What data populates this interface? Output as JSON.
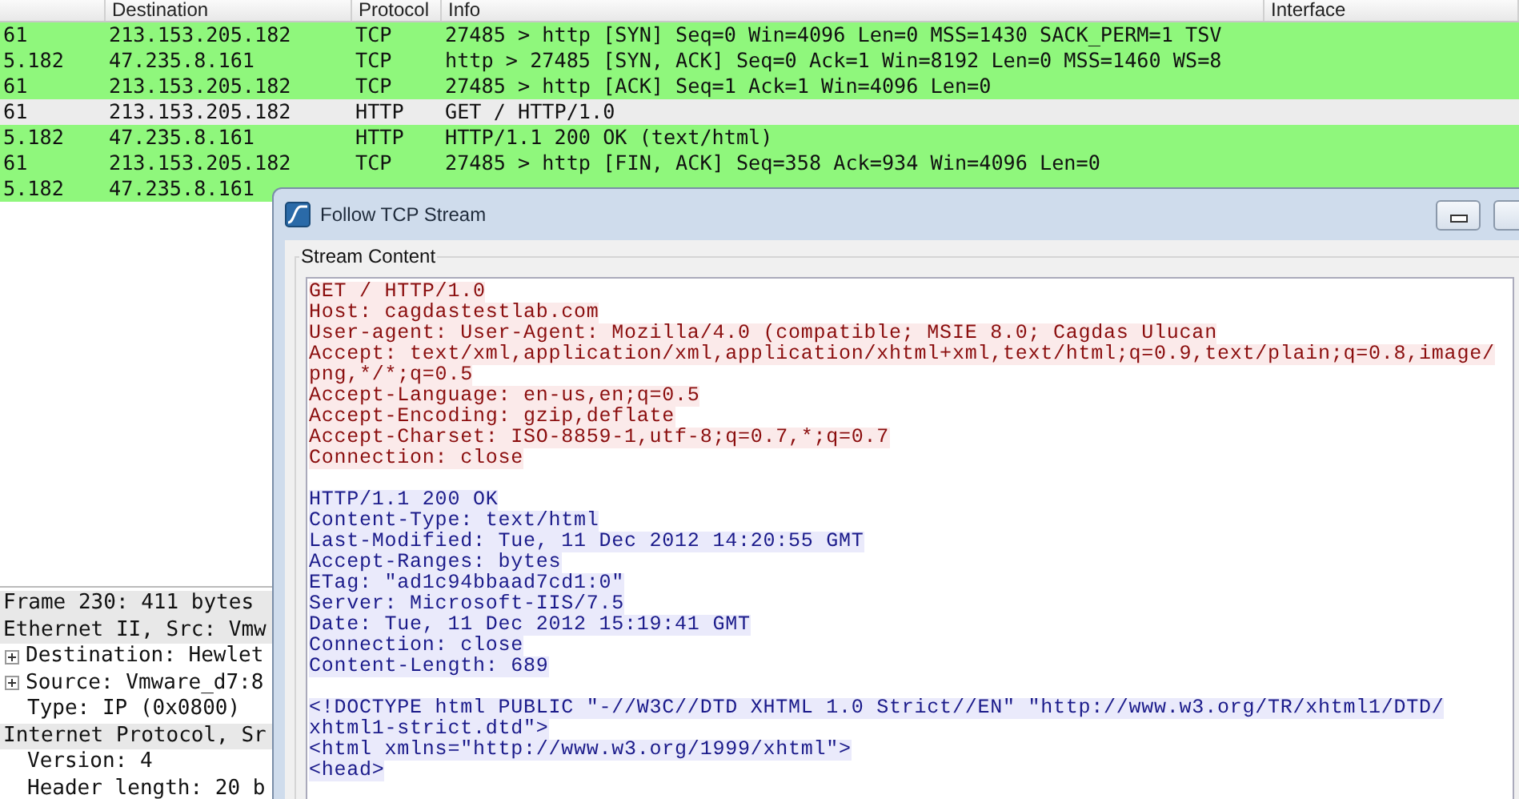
{
  "packet_list": {
    "columns": [
      {},
      {
        "label": "Destination"
      },
      {
        "label": "Protocol"
      },
      {
        "label": "Info"
      },
      {
        "label": "Interface"
      }
    ],
    "rows": [
      {
        "source": "61",
        "destination": "213.153.205.182",
        "protocol": "TCP",
        "info": "27485 > http [SYN] Seq=0 Win=4096 Len=0 MSS=1430 SACK_PERM=1 TSV",
        "selected": false
      },
      {
        "source": "5.182",
        "destination": "47.235.8.161",
        "protocol": "TCP",
        "info": "http > 27485 [SYN, ACK] Seq=0 Ack=1 Win=8192 Len=0 MSS=1460 WS=8",
        "selected": false
      },
      {
        "source": "61",
        "destination": "213.153.205.182",
        "protocol": "TCP",
        "info": "27485 > http [ACK] Seq=1 Ack=1 Win=4096 Len=0",
        "selected": false
      },
      {
        "source": "61",
        "destination": "213.153.205.182",
        "protocol": "HTTP",
        "info": "GET / HTTP/1.0",
        "selected": true
      },
      {
        "source": "5.182",
        "destination": "47.235.8.161",
        "protocol": "HTTP",
        "info": "HTTP/1.1 200 OK  (text/html)",
        "selected": false
      },
      {
        "source": "61",
        "destination": "213.153.205.182",
        "protocol": "TCP",
        "info": "27485 > http [FIN, ACK] Seq=358 Ack=934 Win=4096 Len=0",
        "selected": false
      },
      {
        "source": "5.182",
        "destination": "47.235.8.161",
        "selected": false
      }
    ]
  },
  "packet_details": [
    {
      "label": "Frame 230: 411 bytes"
    },
    {
      "label": "Ethernet II, Src: Vmw",
      "children": [
        {
          "label": "Destination: Hewlet",
          "expanded": false
        },
        {
          "label": "Source: Vmware_d7:8",
          "expanded": false
        },
        {
          "label": "Type: IP (0x0800)"
        }
      ]
    },
    {
      "label": "Internet Protocol, Sr",
      "children": [
        {
          "label": "Version: 4"
        },
        {
          "label": "Header length: 20 b"
        }
      ]
    }
  ],
  "dialog": {
    "title": "Follow TCP Stream",
    "group_label": "Stream Content",
    "segments": [
      {
        "kind": "client",
        "lines": [
          "GET / HTTP/1.0",
          "Host: cagdastestlab.com",
          "User-agent: User-Agent: Mozilla/4.0 (compatible; MSIE 8.0; Cagdas Ulucan",
          "Accept: text/xml,application/xml,application/xhtml+xml,text/html;q=0.9,text/plain;q=0.8,image/",
          "png,*/*;q=0.5",
          "Accept-Language: en-us,en;q=0.5",
          "Accept-Encoding: gzip,deflate",
          "Accept-Charset: ISO-8859-1,utf-8;q=0.7,*;q=0.7",
          "Connection: close"
        ]
      },
      {
        "kind": "server",
        "lines": [
          "HTTP/1.1 200 OK",
          "Content-Type: text/html",
          "Last-Modified: Tue, 11 Dec 2012 14:20:55 GMT",
          "Accept-Ranges: bytes",
          "ETag: \"ad1c94bbaad7cd1:0\"",
          "Server: Microsoft-IIS/7.5",
          "Date: Tue, 11 Dec 2012 15:19:41 GMT",
          "Connection: close",
          "Content-Length: 689"
        ]
      },
      {
        "kind": "server",
        "lines": [
          "<!DOCTYPE html PUBLIC \"-//W3C//DTD XHTML 1.0 Strict//EN\" \"http://www.w3.org/TR/xhtml1/DTD/",
          "xhtml1-strict.dtd\">",
          "<html xmlns=\"http://www.w3.org/1999/xhtml\">",
          "<head>"
        ]
      }
    ]
  }
}
